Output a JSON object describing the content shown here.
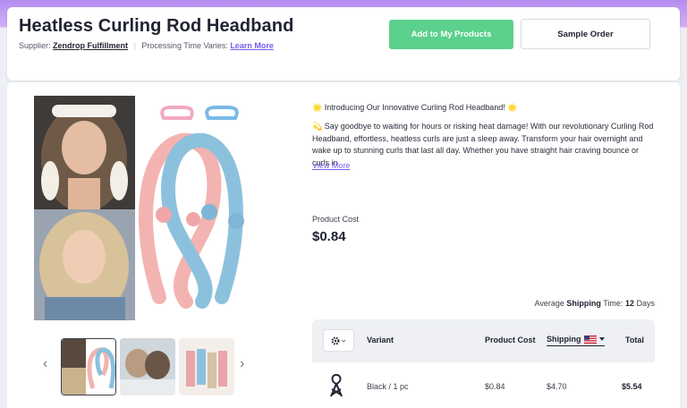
{
  "header": {
    "title": "Heatless Curling Rod Headband",
    "supplier_label": "Supplier:",
    "supplier_name": "Zendrop Fulfillment",
    "processing_label": "Processing Time Varies:",
    "learn_more": "Learn More",
    "add_button": "Add to My Products",
    "sample_button": "Sample Order"
  },
  "gallery": {
    "prev_icon": "chevron-left-icon",
    "next_icon": "chevron-right-icon"
  },
  "description": {
    "intro": "🌟 Introducing Our Innovative Curling Rod Headband! 🌟",
    "body": "💫 Say goodbye to waiting for hours or risking heat damage! With our revolutionary Curling Rod Headband, effortless, heatless curls are just a sleep away. Transform your hair overnight and wake up to stunning curls that last all day. Whether you have straight hair craving bounce or curls in",
    "view_more": "View More"
  },
  "cost": {
    "label": "Product Cost",
    "value": "$0.84"
  },
  "shipping_time": {
    "prefix": "Average",
    "strong": "Shipping",
    "mid": "Time:",
    "days": "12",
    "suffix": "Days"
  },
  "table": {
    "headers": {
      "variant": "Variant",
      "product_cost": "Product Cost",
      "shipping": "Shipping",
      "total": "Total"
    },
    "rows": [
      {
        "variant": "Black / 1 pc",
        "product_cost": "$0.84",
        "shipping": "$4.70",
        "total": "$5.54"
      }
    ]
  },
  "colors": {
    "accent_green": "#5bd18d",
    "link_purple": "#7b5cf0",
    "header_gradient": "#b58cf0"
  }
}
